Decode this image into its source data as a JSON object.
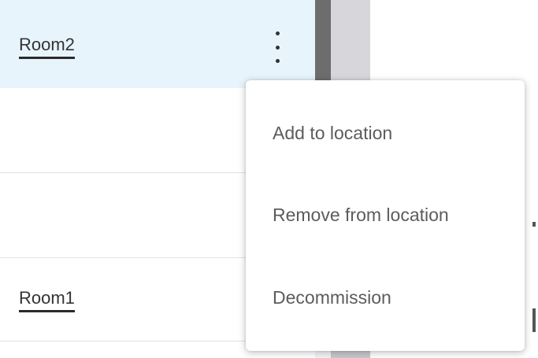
{
  "list": {
    "rows": [
      {
        "label": "Room2",
        "selected": true
      },
      {
        "label": ""
      },
      {
        "label": ""
      },
      {
        "label": "Room1"
      }
    ],
    "more_options_icon": "kebab-vertical-icon"
  },
  "context_menu": {
    "items": [
      {
        "label": "Add to location"
      },
      {
        "label": "Remove from location"
      },
      {
        "label": "Decommission"
      }
    ]
  },
  "colors": {
    "selected_row_bg": "#e8f4fc",
    "menu_text": "#5c5c5c",
    "row_text": "#333333",
    "divider": "#e2e2e2"
  }
}
